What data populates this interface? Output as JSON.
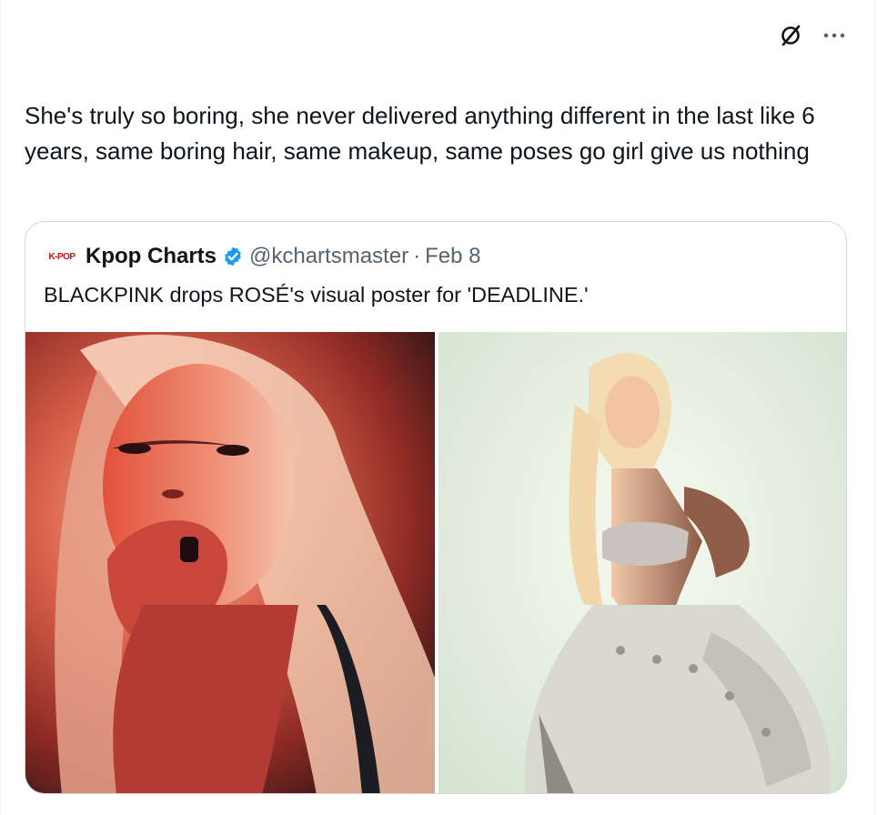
{
  "toolbar": {
    "grok_icon": "grok-icon",
    "more_icon": "more-options-icon"
  },
  "tweet": {
    "text": "She's truly so boring, she never delivered anything different in the last like 6 years, same boring hair, same makeup, same poses go girl give us nothing"
  },
  "quote": {
    "avatar_text": "K-POP",
    "name": "Kpop Charts",
    "verified": true,
    "handle": "@kchartsmaster",
    "separator": "·",
    "date": "Feb 8",
    "text": "BLACKPINK drops ROSÉ's visual poster for 'DEADLINE.'",
    "media": [
      {
        "description": "portrait-red-lighting"
      },
      {
        "description": "full-body-white-outfit"
      }
    ]
  },
  "colors": {
    "text_primary": "#0f1419",
    "text_secondary": "#536471",
    "border": "#cfd9de",
    "verified_blue": "#1d9bf0",
    "avatar_red": "#c0151b"
  }
}
